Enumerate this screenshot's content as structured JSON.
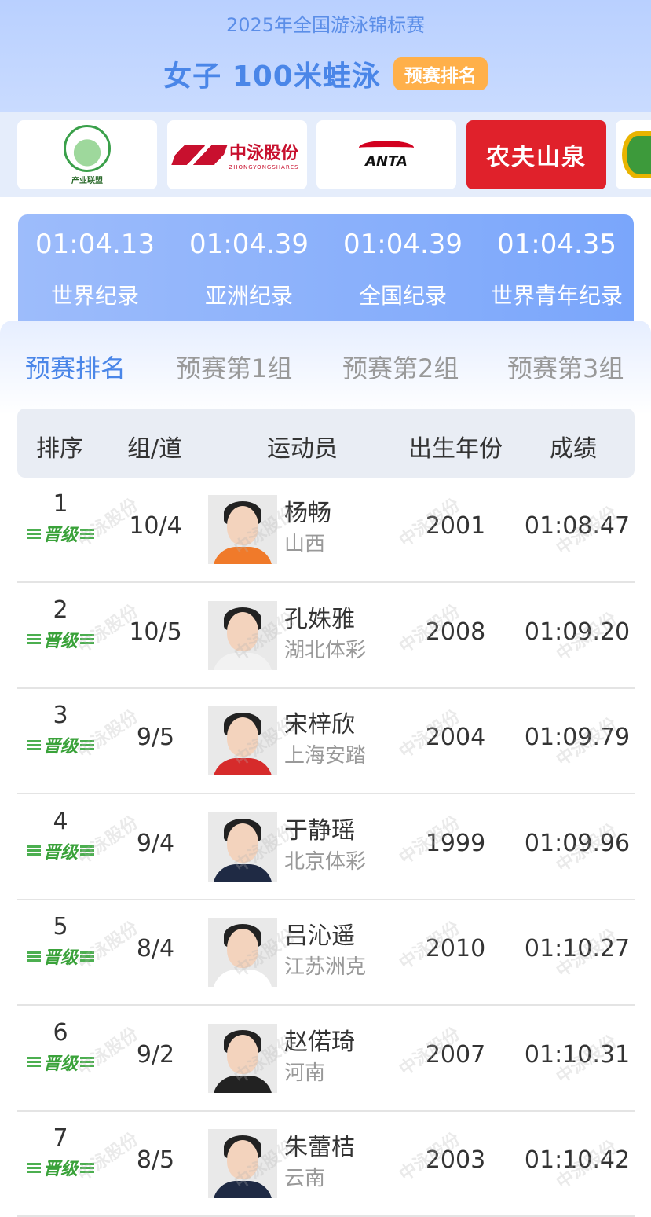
{
  "header": {
    "event": "2025年全国游泳锦标赛",
    "title": "女子 100米蛙泳",
    "badge": "预赛排名"
  },
  "sponsors": {
    "s1_caption": "产业联盟",
    "s2_cn": "中泳股份",
    "s2_en": "ZHONGYONGSHARES",
    "s3": "ANTA",
    "s4": "农夫山泉"
  },
  "records": [
    {
      "time": "01:04.13",
      "label": "世界纪录"
    },
    {
      "time": "01:04.39",
      "label": "亚洲纪录"
    },
    {
      "time": "01:04.39",
      "label": "全国纪录"
    },
    {
      "time": "01:04.35",
      "label": "世界青年纪录"
    }
  ],
  "tabs": [
    "预赛排名",
    "预赛第1组",
    "预赛第2组",
    "预赛第3组"
  ],
  "table": {
    "headers": [
      "排序",
      "组/道",
      "运动员",
      "出生年份",
      "成绩"
    ],
    "qualified_label": "晋级",
    "watermark": "中泳股份",
    "rows": [
      {
        "rank": "1",
        "lane": "10/4",
        "name": "杨畅",
        "team": "山西",
        "year": "2001",
        "result": "01:08.47"
      },
      {
        "rank": "2",
        "lane": "10/5",
        "name": "孔姝雅",
        "team": "湖北体彩",
        "year": "2008",
        "result": "01:09.20"
      },
      {
        "rank": "3",
        "lane": "9/5",
        "name": "宋梓欣",
        "team": "上海安踏",
        "year": "2004",
        "result": "01:09.79"
      },
      {
        "rank": "4",
        "lane": "9/4",
        "name": "于静瑶",
        "team": "北京体彩",
        "year": "1999",
        "result": "01:09.96"
      },
      {
        "rank": "5",
        "lane": "8/4",
        "name": "吕沁遥",
        "team": "江苏洲克",
        "year": "2010",
        "result": "01:10.27"
      },
      {
        "rank": "6",
        "lane": "9/2",
        "name": "赵偌琦",
        "team": "河南",
        "year": "2007",
        "result": "01:10.31"
      },
      {
        "rank": "7",
        "lane": "8/5",
        "name": "朱蕾桔",
        "team": "云南",
        "year": "2003",
        "result": "01:10.42"
      }
    ]
  },
  "colors": {
    "accent": "#4a86e8",
    "badge": "#ffb04a",
    "qualified": "#3aa23a"
  }
}
